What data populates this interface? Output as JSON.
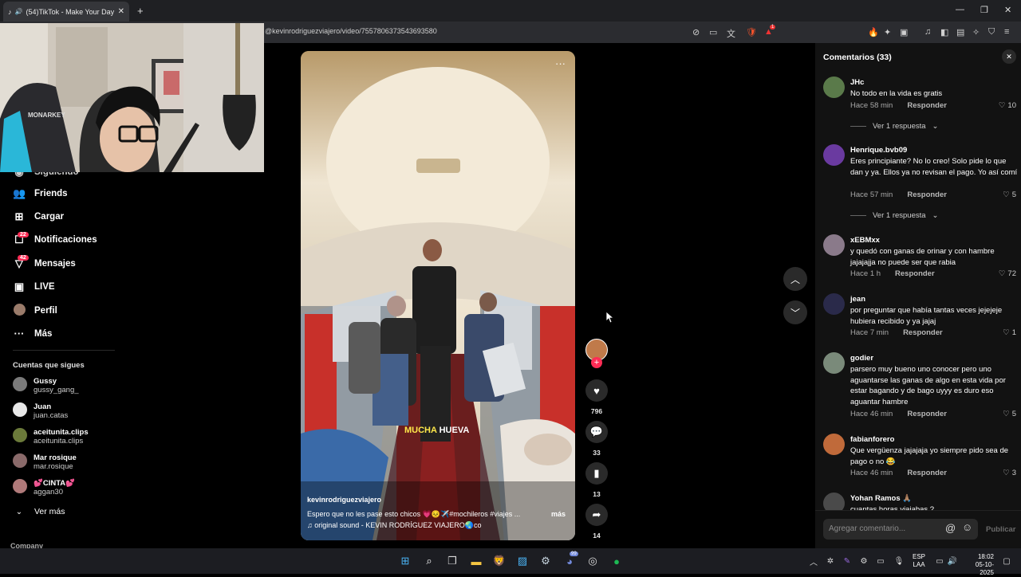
{
  "browser": {
    "tab_title": "(54)TikTok - Make Your Day",
    "new_tab": "+",
    "url": "@kevinrodriguezviajero/video/7557806373543693580",
    "minimize": "—",
    "maximize": "❐",
    "close": "✕",
    "extension_badge": "1"
  },
  "sidebar": {
    "partial_item": "Siguiendo",
    "items": [
      {
        "label": "Friends",
        "icon": "friends-icon",
        "glyph": "👥"
      },
      {
        "label": "Cargar",
        "icon": "upload-icon",
        "glyph": "⊞"
      },
      {
        "label": "Notificaciones",
        "icon": "notifications-icon",
        "glyph": "☐",
        "badge": "22"
      },
      {
        "label": "Mensajes",
        "icon": "messages-icon",
        "glyph": "▽",
        "badge": "42"
      },
      {
        "label": "LIVE",
        "icon": "live-icon",
        "glyph": "▣"
      },
      {
        "label": "Perfil",
        "icon": "profile-icon",
        "glyph": "●"
      },
      {
        "label": "Más",
        "icon": "more-icon",
        "glyph": "···"
      }
    ],
    "following_title": "Cuentas que sigues",
    "following": [
      {
        "name": "Gussy",
        "handle": "gussy_gang_",
        "color": "#7a7a7a"
      },
      {
        "name": "Juan",
        "handle": "juan.catas",
        "color": "#e8e8e8"
      },
      {
        "name": "aceitunita.clips",
        "handle": "aceitunita.clips",
        "color": "#6b7a3a"
      },
      {
        "name": "Mar rosique",
        "handle": "mar.rosique",
        "color": "#8a6a6a"
      },
      {
        "name": "💕CINTA💕",
        "handle": "aggan30",
        "color": "#b07a7a"
      }
    ],
    "see_more": "Ver más",
    "company": "Company"
  },
  "video": {
    "username": "kevinrodriguezviajero",
    "caption": "Espero que no les pase esto chicos 💗😣✈️#mochileros #viajes ...",
    "more": "más",
    "sound": "♫ original sound - KEVIN RODRÍGUEZ VIAJERO🌏co",
    "subtitle_word1": "MUCHA",
    "subtitle_word2": "HUEVA",
    "menu_dots": "···"
  },
  "actions": {
    "likes": "796",
    "comments": "33",
    "saves": "13",
    "shares": "14"
  },
  "comments_panel": {
    "title": "Comentarios (33)",
    "reply_label": "Responder",
    "comments": [
      {
        "user": "JHc",
        "text": "No todo en la vida es gratis",
        "time": "Hace 58 min",
        "likes": "10",
        "replies": "Ver 1 respuesta",
        "color": "#5a7a4a"
      },
      {
        "user": "Henrique.bvb09",
        "text": "Eres principiante? No lo creo! Solo pide lo que dan y ya. Ellos ya no revisan el pago. Yo así comí",
        "time": "Hace 57 min",
        "likes": "5",
        "replies": "Ver 1 respuesta",
        "color": "#6a3aa0"
      },
      {
        "user": "xEBMxx",
        "text": "y quedó con ganas de orinar y con hambre jajajajja no puede ser que rabia",
        "time": "Hace 1 h",
        "likes": "72",
        "color": "#8a7a8a"
      },
      {
        "user": "jean",
        "text": "por preguntar que había tantas veces jejejeje hubiera recibido y ya jajaj",
        "time": "Hace 7 min",
        "likes": "1",
        "color": "#2a2a4a"
      },
      {
        "user": "godier",
        "text": "parsero muy bueno uno conocer pero uno aguantarse las ganas de algo en esta vida por estar bagando y de bago uyyy es duro eso aguantar hambre",
        "time": "Hace 46 min",
        "likes": "5",
        "color": "#7a8a7a"
      },
      {
        "user": "fabianforero",
        "text": "Que vergüenza jajajaja yo siempre pido sea de pago o no 😂",
        "time": "Hace 46 min",
        "likes": "3",
        "color": "#c06a3a"
      },
      {
        "user": "Yohan Ramos 🙏🏽",
        "text": "cuantas horas viajabas ?",
        "color": "#4a4a4a"
      }
    ],
    "input_placeholder": "Agregar comentario...",
    "publish": "Publicar"
  },
  "taskbar": {
    "lang": "ESP",
    "lang2": "LAA",
    "time": "18:02",
    "date": "05-10-2025",
    "discord_badge": "99"
  }
}
